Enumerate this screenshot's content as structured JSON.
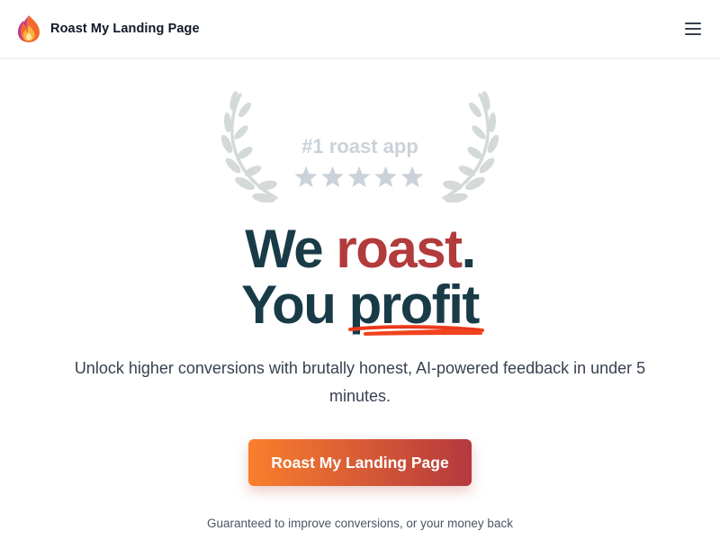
{
  "header": {
    "brand_name": "Roast My Landing Page",
    "logo_icon": "flame-icon",
    "menu_icon": "hamburger-menu-icon"
  },
  "badge": {
    "text": "#1 roast app",
    "rating": 5,
    "rating_max": 5,
    "left_icon": "laurel-branch-icon",
    "right_icon": "laurel-branch-icon"
  },
  "hero": {
    "line1_prefix": "We ",
    "line1_accent": "roast",
    "line1_suffix": ".",
    "line2_prefix": "You ",
    "line2_underlined": "profit",
    "subtitle": "Unlock higher conversions with brutally honest, AI-powered feedback in under 5 minutes.",
    "cta_label": "Roast My Landing Page",
    "guarantee": "Guaranteed to improve conversions, or your money back"
  },
  "colors": {
    "headline": "#183b47",
    "accent": "#b23b3b",
    "cta_start": "#f97f2c",
    "cta_end": "#b5383e",
    "badge_gray": "#cbd2d9",
    "underline": "#f0431e"
  }
}
